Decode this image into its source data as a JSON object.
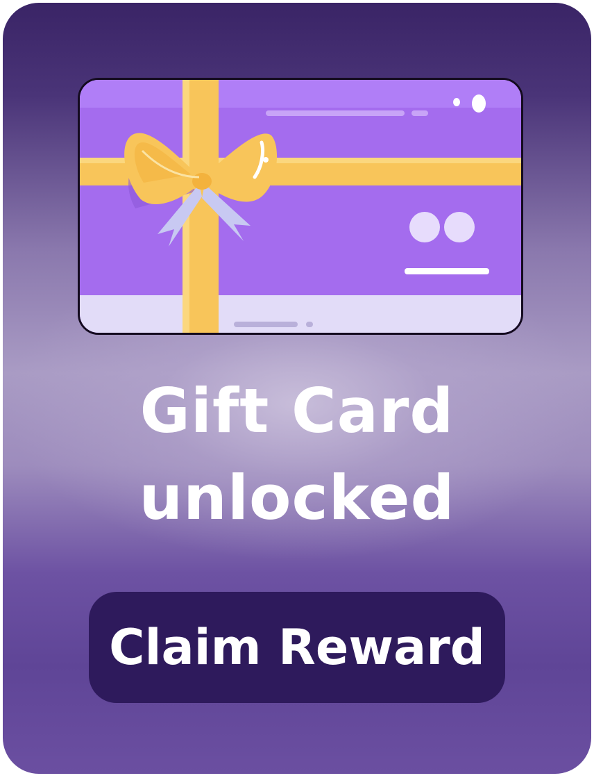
{
  "reward": {
    "headline_line1": "Gift  Card",
    "headline_line2": "unlocked",
    "claim_button_label": "Claim Reward",
    "illustration_icon": "gift-card-icon"
  },
  "colors": {
    "panel_top": "#3a2466",
    "panel_bottom": "#6b4fa1",
    "card_purple": "#a46cee",
    "ribbon_yellow": "#f8c55a",
    "button_bg": "#2e1a5c",
    "text": "#ffffff"
  }
}
